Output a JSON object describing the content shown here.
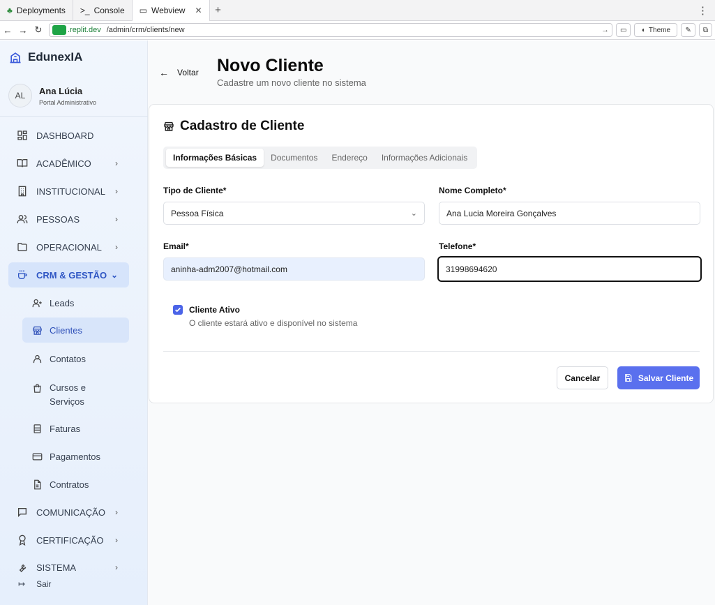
{
  "browser": {
    "tabs": [
      {
        "label": "Deployments",
        "icon": "sprout-icon"
      },
      {
        "label": "Console",
        "icon": "terminal-icon"
      },
      {
        "label": "Webview",
        "icon": "monitor-icon",
        "active": true
      }
    ],
    "url_host": ".replit.dev",
    "url_path": "/admin/crm/clients/new",
    "theme_label": "Theme"
  },
  "sidebar": {
    "brand": "EdunexIA",
    "user": {
      "initials": "AL",
      "name": "Ana Lúcia",
      "role": "Portal Administrativo"
    },
    "items": [
      {
        "label": "DASHBOARD"
      },
      {
        "label": "ACADÊMICO"
      },
      {
        "label": "INSTITUCIONAL"
      },
      {
        "label": "PESSOAS"
      },
      {
        "label": "OPERACIONAL"
      },
      {
        "label": "CRM & GESTÃO"
      },
      {
        "label": "COMUNICAÇÃO"
      },
      {
        "label": "CERTIFICAÇÃO"
      },
      {
        "label": "SISTEMA"
      }
    ],
    "crm_sub": [
      {
        "label": "Leads"
      },
      {
        "label": "Clientes"
      },
      {
        "label": "Contatos"
      },
      {
        "label": "Cursos e",
        "label2": "Serviços"
      },
      {
        "label": "Faturas"
      },
      {
        "label": "Pagamentos"
      },
      {
        "label": "Contratos"
      }
    ],
    "logout": "Sair"
  },
  "page": {
    "back": "Voltar",
    "title": "Novo Cliente",
    "subtitle": "Cadastre um novo cliente no sistema"
  },
  "form": {
    "title": "Cadastro de Cliente",
    "tabs": [
      "Informações Básicas",
      "Documentos",
      "Endereço",
      "Informações Adicionais"
    ],
    "tipo_label": "Tipo de Cliente*",
    "tipo_value": "Pessoa Física",
    "nome_label": "Nome Completo*",
    "nome_value": "Ana Lucia Moreira Gonçalves",
    "email_label": "Email*",
    "email_value": "aninha-adm2007@hotmail.com",
    "telefone_label": "Telefone*",
    "telefone_value": "31998694620",
    "ativo_label": "Cliente Ativo",
    "ativo_desc": "O cliente estará ativo e disponível no sistema",
    "ativo_checked": true,
    "cancel": "Cancelar",
    "save": "Salvar Cliente"
  },
  "colors": {
    "accent": "#5a70ee",
    "sidebar_active": "#d6e4fb"
  }
}
